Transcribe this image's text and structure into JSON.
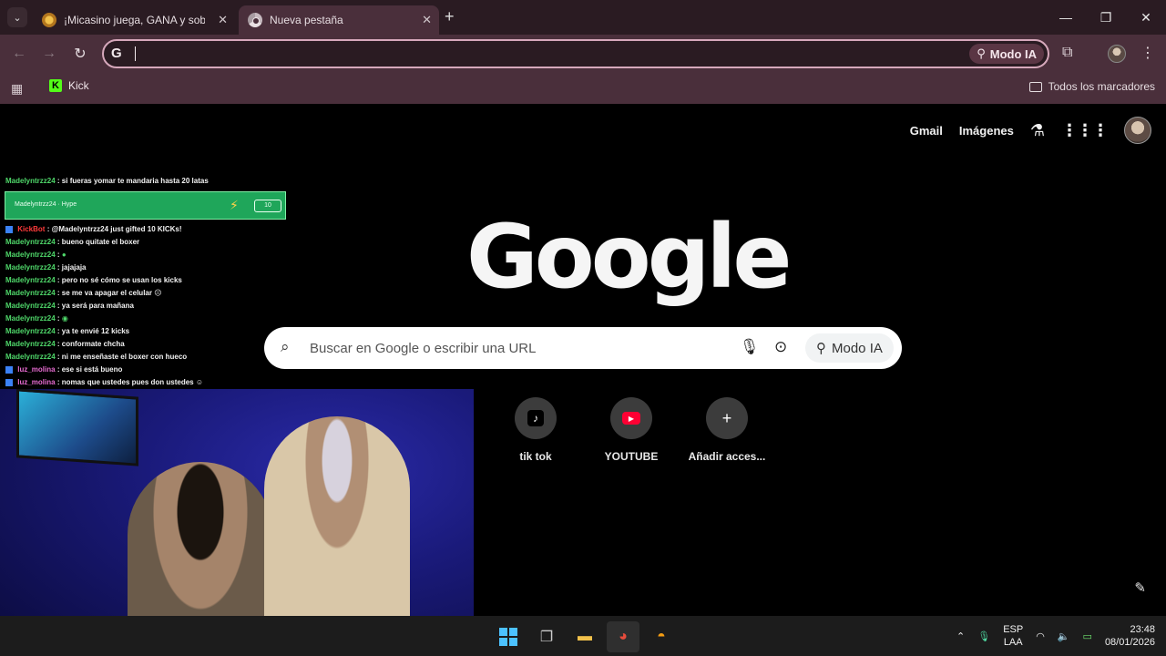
{
  "browser": {
    "tabs": [
      {
        "title": "¡Micasino juega, GANA y sobre",
        "active": false
      },
      {
        "title": "Nueva pestaña",
        "active": true
      }
    ],
    "omnibox": {
      "value": "",
      "ai_mode_label": "Modo IA"
    },
    "bookmarks": {
      "kick_label": "Kick",
      "all_bookmarks_label": "Todos los marcadores"
    }
  },
  "ntp": {
    "gmail_label": "Gmail",
    "images_label": "Imágenes",
    "logo_text": "Google",
    "search_placeholder": "Buscar en Google o escribir una URL",
    "ai_mode_label": "Modo IA",
    "shortcuts": [
      {
        "label": "tik tok",
        "icon": "tiktok-icon"
      },
      {
        "label": "YOUTUBE",
        "icon": "youtube-icon"
      },
      {
        "label": "Añadir acces...",
        "icon": "plus-icon"
      }
    ]
  },
  "chat": {
    "top_line": {
      "user": "Madelyntrzz24",
      "text": ": si fueras yomar te mandaria hasta 20 latas"
    },
    "hype": {
      "text": "Madelyntrzz24 · Hype",
      "count": "10"
    },
    "messages": [
      {
        "user": "KickBot",
        "text": ": @Madelyntrzz24 just gifted 10 KICKs!"
      },
      {
        "user": "Madelyntrzz24",
        "text": ": bueno quitate el boxer"
      },
      {
        "user": "Madelyntrzz24",
        "text": ":"
      },
      {
        "user": "Madelyntrzz24",
        "text": ": jajajaja"
      },
      {
        "user": "Madelyntrzz24",
        "text": ": pero no sé cómo se usan los kicks"
      },
      {
        "user": "Madelyntrzz24",
        "text": ": se me va apagar el celular"
      },
      {
        "user": "Madelyntrzz24",
        "text": ": ya será para mañana"
      },
      {
        "user": "Madelyntrzz24",
        "text": ":"
      },
      {
        "user": "Madelyntrzz24",
        "text": ": ya te envié 12 kicks"
      },
      {
        "user": "Madelyntrzz24",
        "text": ": conformate chcha"
      },
      {
        "user": "Madelyntrzz24",
        "text": ": ni me enseñaste el boxer con hueco"
      },
      {
        "user": "luz_molina",
        "text": ": ese si está bueno"
      },
      {
        "user": "luz_molina",
        "text": ": nomas que ustedes pues don ustedes"
      }
    ]
  },
  "taskbar": {
    "lang_top": "ESP",
    "lang_bottom": "LAA",
    "time": "23:48",
    "date": "08/01/2026"
  },
  "colors": {
    "accent": "#4a2f3b",
    "tabstrip": "#2a1b22",
    "omnibox_border": "#d6a8bb"
  }
}
